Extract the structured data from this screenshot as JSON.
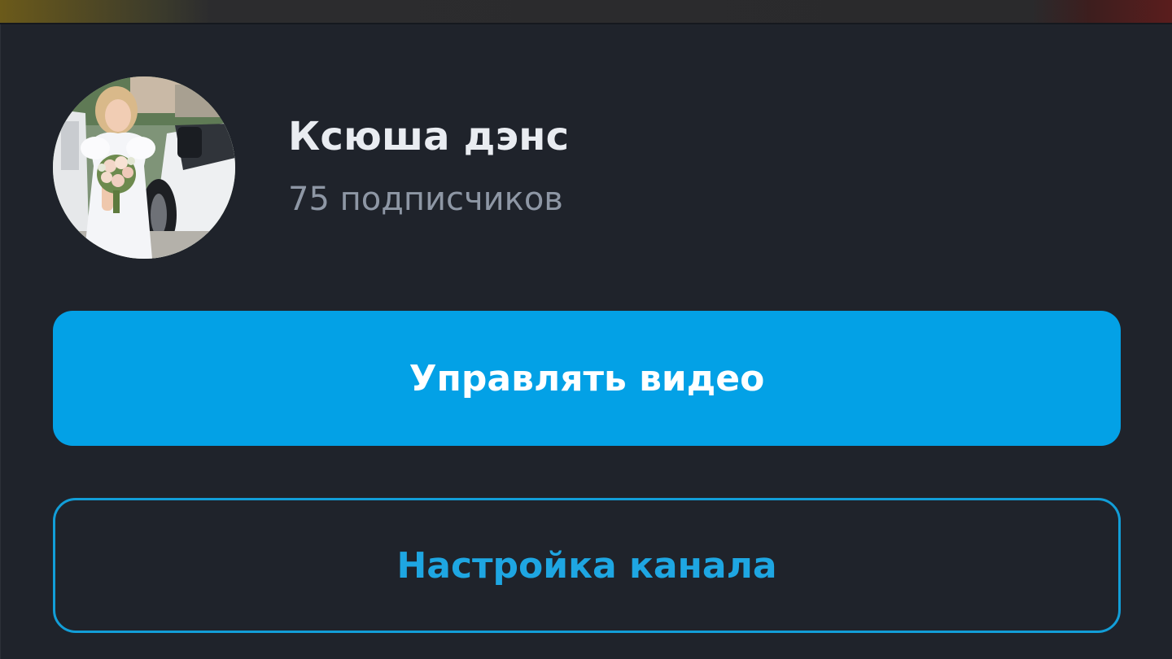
{
  "channel": {
    "name": "Ксюша дэнс",
    "subscribers": "75 подписчиков"
  },
  "actions": {
    "manage_videos_label": "Управлять видео",
    "channel_settings_label": "Настройка канала"
  },
  "colors": {
    "background": "#1f232b",
    "primary_button": "#03a1e6",
    "outline_button": "#129ed8",
    "name_text": "#e9ecf1",
    "secondary_text": "#8e97a5"
  }
}
